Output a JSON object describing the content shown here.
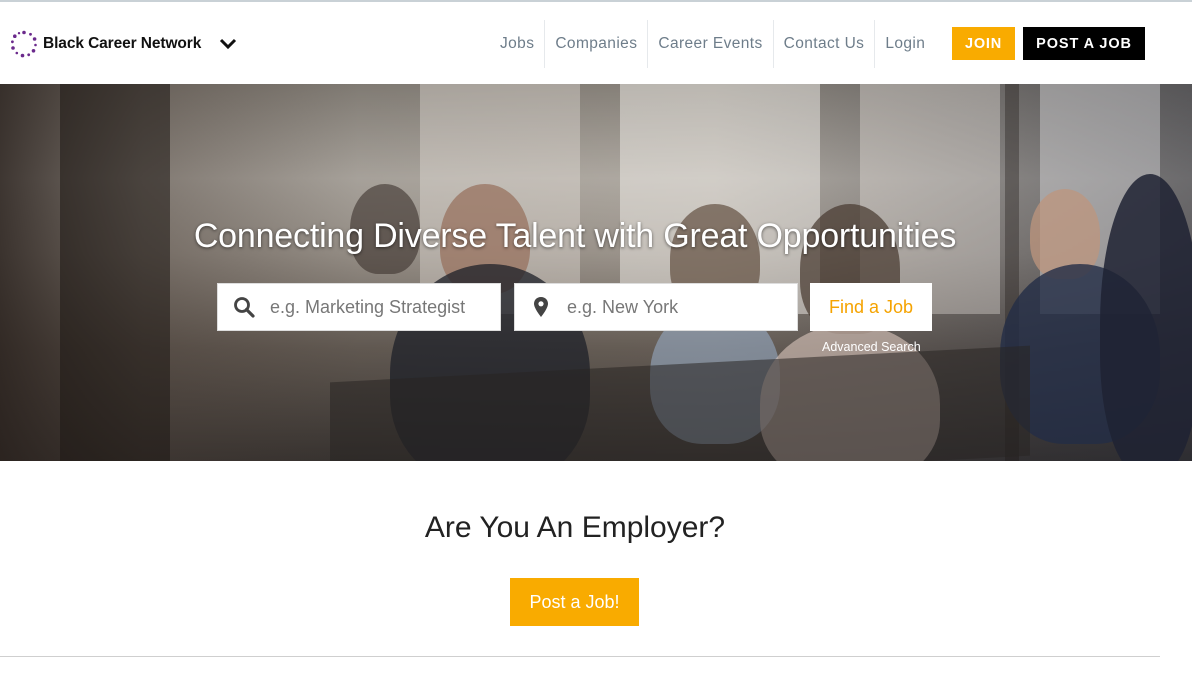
{
  "header": {
    "logo_text": "Black Career Network",
    "nav": [
      "Jobs",
      "Companies",
      "Career Events",
      "Contact Us",
      "Login"
    ],
    "join_label": "JOIN",
    "post_job_label": "POST A JOB"
  },
  "hero": {
    "title": "Connecting Diverse Talent with Great Opportunities",
    "keyword_placeholder": "e.g. Marketing Strategist",
    "location_placeholder": "e.g. New York",
    "find_label": "Find a Job",
    "advanced_label": "Advanced Search"
  },
  "employer": {
    "title": "Are You An Employer?",
    "button_label": "Post a Job!"
  },
  "colors": {
    "accent": "#f9ab00",
    "logo_purple": "#6b2a8c",
    "nav_text": "#6e7d8a"
  },
  "icons": [
    "chevron-down-icon",
    "search-icon",
    "location-pin-icon",
    "logo-dots-icon"
  ]
}
